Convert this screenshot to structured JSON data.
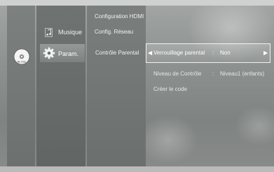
{
  "device": {
    "icon": "disc-icon",
    "disc_label": "No Disc"
  },
  "main_menu": {
    "items": [
      {
        "label": "Musique",
        "icon": "music-note-icon"
      },
      {
        "label": "Param.",
        "icon": "gear-icon",
        "selected": true
      }
    ]
  },
  "sub_menu": {
    "items": [
      {
        "label": "Configuration HDMI"
      },
      {
        "label": "Config. Réseau"
      },
      {
        "label": "Contrôle Parental",
        "selected": true
      }
    ]
  },
  "options": [
    {
      "label": "Verrouillage parental",
      "separator": ":",
      "value": "Non",
      "highlighted": true
    },
    {
      "label": "Niveau de Contrôle",
      "separator": ":",
      "value": "Niveau1 (enfants)",
      "highlighted": false
    },
    {
      "label": "Créer le code",
      "highlighted": false
    }
  ],
  "colors": {
    "background": "#8e9291",
    "highlight_border": "#ffffff",
    "text": "#ffffff"
  }
}
